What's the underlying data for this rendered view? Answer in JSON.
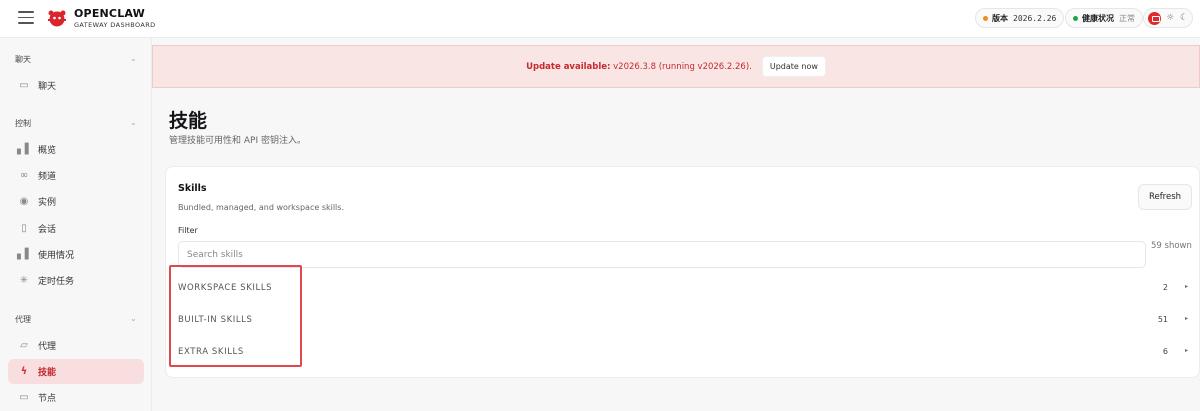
{
  "header": {
    "brand_title": "OPENCLAW",
    "brand_subtitle": "GATEWAY DASHBOARD",
    "version_label": "版本",
    "version_value": "2026.2.26",
    "health_label": "健康状况",
    "health_value": "正常",
    "icons": [
      "menu-icon",
      "logo-icon",
      "monitor-icon",
      "sun-icon",
      "moon-icon"
    ],
    "colors": {
      "accent": "#e0282d",
      "version_dot": "#f28c1c",
      "health_dot": "#21a447"
    }
  },
  "sidebar": {
    "sections": [
      {
        "label": "聊天",
        "items": [
          {
            "label": "聊天",
            "icon": "chat-icon"
          }
        ]
      },
      {
        "label": "控制",
        "items": [
          {
            "label": "概览",
            "icon": "bar-chart-icon"
          },
          {
            "label": "频道",
            "icon": "link-icon"
          },
          {
            "label": "实例",
            "icon": "broadcast-icon"
          },
          {
            "label": "会话",
            "icon": "document-icon"
          },
          {
            "label": "使用情况",
            "icon": "bar-chart-icon"
          },
          {
            "label": "定时任务",
            "icon": "loader-icon"
          }
        ]
      },
      {
        "label": "代理",
        "items": [
          {
            "label": "代理",
            "icon": "folder-icon"
          },
          {
            "label": "技能",
            "icon": "lightning-icon",
            "active": true
          },
          {
            "label": "节点",
            "icon": "monitor-icon"
          }
        ]
      }
    ]
  },
  "banner": {
    "strong": "Update available:",
    "text": " v2026.3.8 (running v2026.2.26).",
    "button": "Update now"
  },
  "page": {
    "title": "技能",
    "subtitle": "管理技能可用性和 API 密钥注入。"
  },
  "skills_card": {
    "title": "Skills",
    "subtitle": "Bundled, managed, and workspace skills.",
    "refresh_label": "Refresh",
    "filter_label": "Filter",
    "search_placeholder": "Search skills",
    "shown_text": "59 shown",
    "groups": [
      {
        "name": "WORKSPACE SKILLS",
        "count": "2"
      },
      {
        "name": "BUILT-IN SKILLS",
        "count": "51"
      },
      {
        "name": "EXTRA SKILLS",
        "count": "6"
      }
    ]
  }
}
